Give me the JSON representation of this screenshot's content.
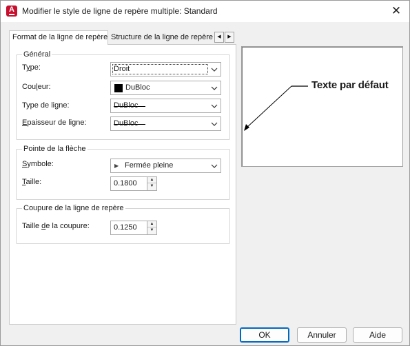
{
  "window": {
    "title": "Modifier le style de ligne de repère multiple: Standard",
    "app_icon_letter": "A",
    "close_glyph": "✕"
  },
  "tabs": {
    "items": [
      {
        "label": "Format de la ligne de repère",
        "active": true
      },
      {
        "label": "Structure de la ligne de repère",
        "active": false
      }
    ],
    "scroll_left": "◀",
    "scroll_right": "▶"
  },
  "general": {
    "title": "Général",
    "type": {
      "label_before": "T",
      "label_mnemonic": "y",
      "label_after": "pe:",
      "value": "Droit"
    },
    "color": {
      "label_before": "Cou",
      "label_mnemonic": "l",
      "label_after": "eur:",
      "value": "DuBloc",
      "swatch_color": "#000000"
    },
    "linetype": {
      "label_before": "Type de li",
      "label_mnemonic": "g",
      "label_after": "ne:",
      "value": "DuBloc"
    },
    "lineweight": {
      "label_before": "",
      "label_mnemonic": "E",
      "label_after": "paisseur de ligne:",
      "value": "DuBloc"
    }
  },
  "arrowhead": {
    "title": "Pointe de la flèche",
    "symbol": {
      "label_before": "",
      "label_mnemonic": "S",
      "label_after": "ymbole:",
      "value": "Fermée pleine",
      "glyph": "▶"
    },
    "size": {
      "label_before": "",
      "label_mnemonic": "T",
      "label_after": "aille:",
      "value": "0.1800"
    }
  },
  "landing_break": {
    "title": "Coupure de la ligne de repère",
    "break_size": {
      "label_before": "Taille ",
      "label_mnemonic": "d",
      "label_after": "e la coupure:",
      "value": "0.1250"
    }
  },
  "preview": {
    "text": "Texte par défaut"
  },
  "buttons": {
    "ok": "OK",
    "cancel": "Annuler",
    "help": "Aide"
  },
  "icons": {
    "dropdown": "chevron-down-icon",
    "spin_up": "▲",
    "spin_down": "▼"
  },
  "colors": {
    "app_icon": "#c8102e",
    "primary_button_border": "#0067c0"
  }
}
